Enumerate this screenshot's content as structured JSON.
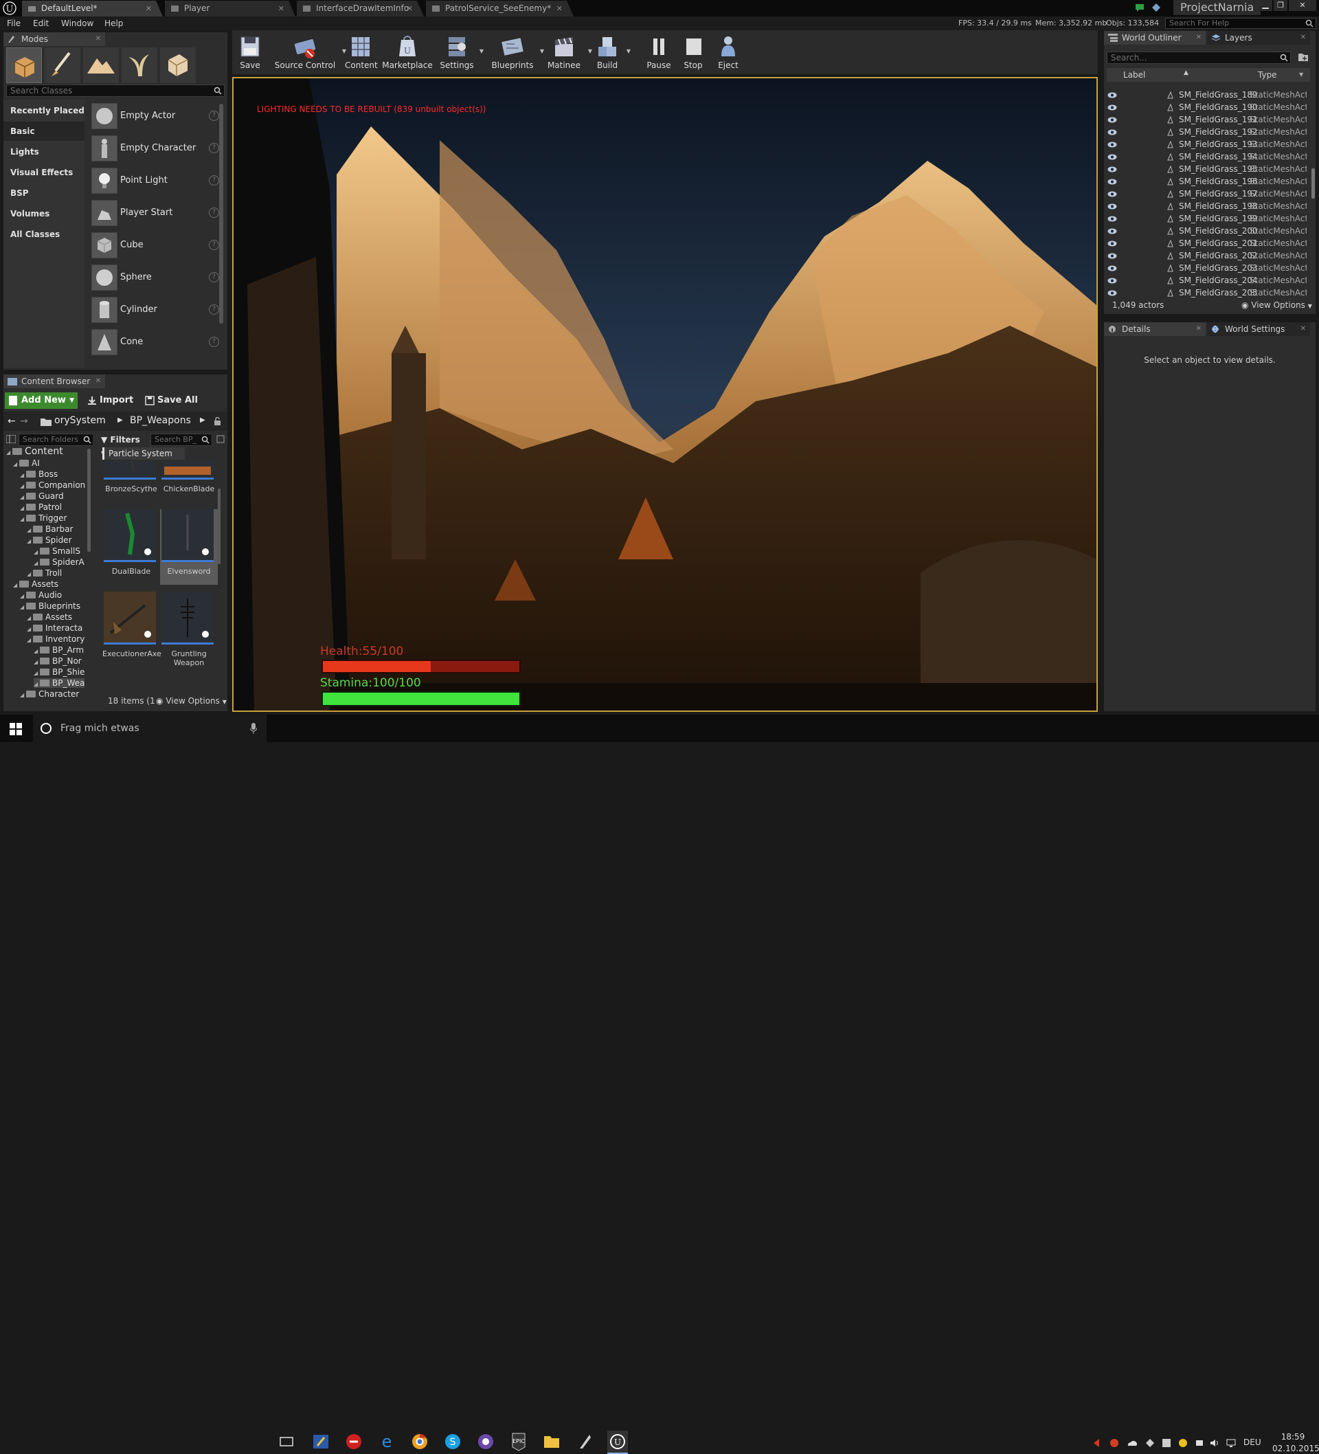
{
  "window": {
    "title": "ProjectNarnia",
    "tabs": [
      "DefaultLevel*",
      "Player",
      "InterfaceDrawItemInfo",
      "PatrolService_SeeEnemy*"
    ],
    "search_help_placeholder": "Search For Help"
  },
  "menu": [
    "File",
    "Edit",
    "Window",
    "Help"
  ],
  "stats": {
    "fps": "FPS: 33.4 / 29.9 ms",
    "mem": "Mem: 3,352.92 mb",
    "objs": "Objs: 133,584"
  },
  "modes": {
    "tab_label": "Modes",
    "search_placeholder": "Search Classes",
    "categories": [
      "Recently Placed",
      "Basic",
      "Lights",
      "Visual Effects",
      "BSP",
      "Volumes",
      "All Classes"
    ],
    "selected_category": "Basic",
    "items": [
      "Empty Actor",
      "Empty Character",
      "Point Light",
      "Player Start",
      "Cube",
      "Sphere",
      "Cylinder",
      "Cone"
    ]
  },
  "toolbar": [
    {
      "label": "Save",
      "icon": "save-icon"
    },
    {
      "label": "Source Control",
      "icon": "source-control-icon"
    },
    {
      "label": "Content",
      "icon": "content-icon"
    },
    {
      "label": "Marketplace",
      "icon": "marketplace-icon"
    },
    {
      "label": "Settings",
      "icon": "settings-icon"
    },
    {
      "label": "Blueprints",
      "icon": "blueprints-icon"
    },
    {
      "label": "Matinee",
      "icon": "matinee-icon"
    },
    {
      "label": "Build",
      "icon": "build-icon"
    },
    {
      "label": "Pause",
      "icon": "pause-icon"
    },
    {
      "label": "Stop",
      "icon": "stop-icon"
    },
    {
      "label": "Eject",
      "icon": "eject-icon"
    }
  ],
  "viewport": {
    "warning": "LIGHTING NEEDS TO BE REBUILT (839 unbuilt object(s))",
    "health_label": "Health:55/100",
    "stamina_label": "Stamina:100/100",
    "health_fraction": 0.55,
    "stamina_fraction": 1.0
  },
  "content_browser": {
    "tab_label": "Content Browser",
    "add_new": "Add New",
    "import": "Import",
    "save_all": "Save All",
    "path": [
      "orySystem",
      "BP_Weapons"
    ],
    "search_folders_placeholder": "Search Folders",
    "filters": "Filters",
    "search_bp_placeholder": "Search BP_",
    "filter_chip": "Particle System",
    "tree": [
      {
        "label": "Content",
        "depth": 0
      },
      {
        "label": "AI",
        "depth": 1
      },
      {
        "label": "Boss",
        "depth": 2
      },
      {
        "label": "Companion",
        "depth": 2
      },
      {
        "label": "Guard",
        "depth": 2
      },
      {
        "label": "Patrol",
        "depth": 2
      },
      {
        "label": "Trigger",
        "depth": 2
      },
      {
        "label": "Barbar",
        "depth": 3
      },
      {
        "label": "Spider",
        "depth": 3
      },
      {
        "label": "SmallS",
        "depth": 4
      },
      {
        "label": "SpiderA",
        "depth": 4
      },
      {
        "label": "Troll",
        "depth": 3
      },
      {
        "label": "Assets",
        "depth": 1
      },
      {
        "label": "Audio",
        "depth": 2
      },
      {
        "label": "Blueprints",
        "depth": 2
      },
      {
        "label": "Assets",
        "depth": 3
      },
      {
        "label": "Interacta",
        "depth": 3
      },
      {
        "label": "Inventory",
        "depth": 3
      },
      {
        "label": "BP_Arm",
        "depth": 4
      },
      {
        "label": "BP_Nor",
        "depth": 4
      },
      {
        "label": "BP_Shie",
        "depth": 4
      },
      {
        "label": "BP_Wea",
        "depth": 4
      },
      {
        "label": "Character",
        "depth": 2
      }
    ],
    "assets": [
      "BronzeScythe",
      "ChickenBlade",
      "DualBlade",
      "Elvensword",
      "ExecutionerAxe",
      "Gruntling Weapon"
    ],
    "item_count": "18 items (1",
    "view_options": "View Options"
  },
  "outliner": {
    "tab_label": "World Outliner",
    "layers_tab": "Layers",
    "search_placeholder": "Search...",
    "col_label": "Label",
    "col_type": "Type",
    "rows": [
      {
        "name": "SM_FieldGrass_189",
        "type": "StaticMeshActor"
      },
      {
        "name": "SM_FieldGrass_190",
        "type": "StaticMeshActor"
      },
      {
        "name": "SM_FieldGrass_191",
        "type": "StaticMeshActor"
      },
      {
        "name": "SM_FieldGrass_192",
        "type": "StaticMeshActor"
      },
      {
        "name": "SM_FieldGrass_193",
        "type": "StaticMeshActor"
      },
      {
        "name": "SM_FieldGrass_194",
        "type": "StaticMeshActor"
      },
      {
        "name": "SM_FieldGrass_195",
        "type": "StaticMeshActor"
      },
      {
        "name": "SM_FieldGrass_196",
        "type": "StaticMeshActor"
      },
      {
        "name": "SM_FieldGrass_197",
        "type": "StaticMeshActor"
      },
      {
        "name": "SM_FieldGrass_198",
        "type": "StaticMeshActor"
      },
      {
        "name": "SM_FieldGrass_199",
        "type": "StaticMeshActor"
      },
      {
        "name": "SM_FieldGrass_200",
        "type": "StaticMeshActor"
      },
      {
        "name": "SM_FieldGrass_201",
        "type": "StaticMeshActor"
      },
      {
        "name": "SM_FieldGrass_202",
        "type": "StaticMeshActor"
      },
      {
        "name": "SM_FieldGrass_203",
        "type": "StaticMeshActor"
      },
      {
        "name": "SM_FieldGrass_204",
        "type": "StaticMeshActor"
      },
      {
        "name": "SM_FieldGrass_205",
        "type": "StaticMeshActor"
      }
    ],
    "actor_count": "1,049 actors",
    "view_options": "View Options"
  },
  "details": {
    "tab_label": "Details",
    "world_settings_tab": "World Settings",
    "empty_message": "Select an object to view details."
  },
  "taskbar": {
    "search_placeholder": "Frag mich etwas",
    "language": "DEU",
    "time": "18:59",
    "date": "02.10.2015"
  },
  "colors": {
    "accent_green": "#3d8a2e",
    "warning_red": "#ff2a2a",
    "health": "#e8381c",
    "stamina": "#3fe33c",
    "viewport_border": "#c9a23a"
  }
}
